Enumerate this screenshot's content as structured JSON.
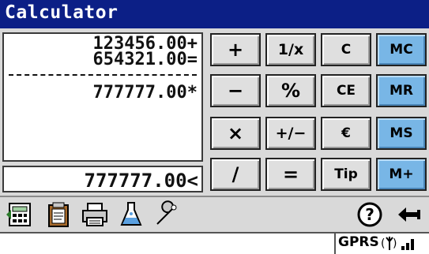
{
  "window": {
    "title": "Calculator"
  },
  "tape": {
    "lines": [
      "123456.00+",
      "654321.00=",
      "777777.00*"
    ]
  },
  "display": {
    "value": "777777.00<"
  },
  "keypad": {
    "rows": [
      [
        "+",
        "1/x",
        "C",
        "MC"
      ],
      [
        "−",
        "%",
        "CE",
        "MR"
      ],
      [
        "×",
        "+/−",
        "€",
        "MS"
      ],
      [
        "/",
        "=",
        "Tip",
        "M+"
      ]
    ],
    "memory_key_color": "#78b6e6"
  },
  "toolbar": {
    "icons": [
      "calculator-icon",
      "clipboard-icon",
      "printer-icon",
      "flask-icon",
      "wrench-icon",
      "help-icon",
      "back-arrow-icon"
    ]
  },
  "status": {
    "network_label": "GPRS"
  },
  "colors": {
    "title_bar": "#0c1f86",
    "body": "#d9d9d9"
  }
}
